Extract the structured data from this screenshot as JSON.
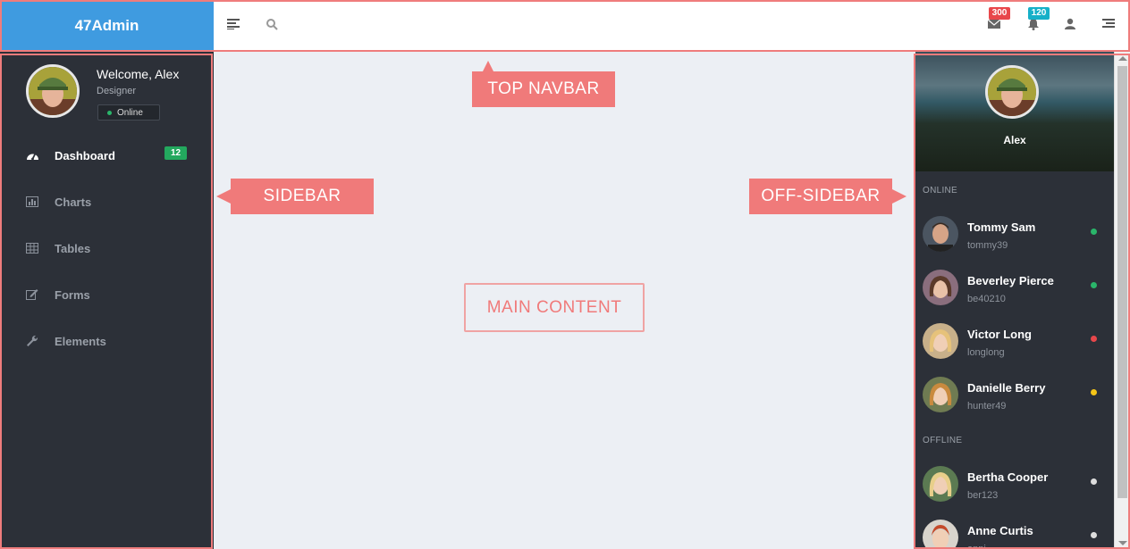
{
  "brand": {
    "title": "47Admin"
  },
  "topnav": {
    "icons": [
      "menu-lines-icon",
      "search-icon",
      "envelope-icon",
      "bell-icon",
      "user-icon",
      "list-menu-icon"
    ],
    "mail_badge": "300",
    "notif_badge": "120",
    "colors": {
      "mail_badge": "#e8474b",
      "notif_badge": "#16b0c8",
      "brand": "#3f9be0"
    }
  },
  "sidebar": {
    "profile": {
      "welcome": "Welcome, Alex",
      "role": "Designer",
      "status": "Online"
    },
    "items": [
      {
        "label": "Dashboard",
        "icon": "dashboard-gauge-icon",
        "active": true,
        "badge": "12"
      },
      {
        "label": "Charts",
        "icon": "bar-chart-icon"
      },
      {
        "label": "Tables",
        "icon": "table-grid-icon"
      },
      {
        "label": "Forms",
        "icon": "edit-form-icon"
      },
      {
        "label": "Elements",
        "icon": "wrench-icon"
      }
    ]
  },
  "callouts": {
    "top_navbar": "TOP NAVBAR",
    "sidebar": "SIDEBAR",
    "off_sidebar": "OFF-SIDEBAR",
    "main_content": "MAIN CONTENT"
  },
  "offsidebar": {
    "user_name": "Alex",
    "online_label": "ONLINE",
    "offline_label": "OFFLINE",
    "online": [
      {
        "name": "Tommy Sam",
        "username": "tommy39",
        "status_color": "#2ab56a"
      },
      {
        "name": "Beverley Pierce",
        "username": "be40210",
        "status_color": "#2ab56a"
      },
      {
        "name": "Victor Long",
        "username": "longlong",
        "status_color": "#e8474b"
      },
      {
        "name": "Danielle Berry",
        "username": "hunter49",
        "status_color": "#f5c518"
      }
    ],
    "offline": [
      {
        "name": "Bertha Cooper",
        "username": "ber123",
        "status_color": "#dddddd"
      },
      {
        "name": "Anne Curtis",
        "username": "anni",
        "status_color": "#dddddd"
      }
    ]
  }
}
